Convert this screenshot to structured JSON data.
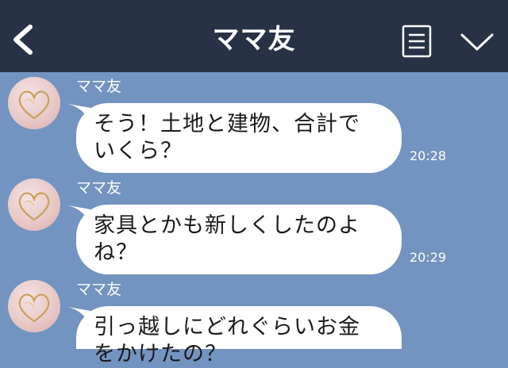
{
  "header": {
    "title": "ママ友"
  },
  "messages": [
    {
      "sender": "ママ友",
      "text": "そう！土地と建物、合計で\nいくら？",
      "time": "20:28"
    },
    {
      "sender": "ママ友",
      "text": "家具とかも新しくしたのよ\nね？",
      "time": "20:29"
    },
    {
      "sender": "ママ友",
      "text": "引っ越しにどれぐらいお金\nをかけたの？",
      "time": ""
    }
  ],
  "colors": {
    "header_bg": "#273246",
    "chat_bg": "#7394c0",
    "bubble_bg": "#ffffff",
    "header_text": "#ffffff"
  },
  "icons": [
    "back-chevron-icon",
    "menu-icon",
    "chevron-down-icon",
    "heart-avatar"
  ]
}
